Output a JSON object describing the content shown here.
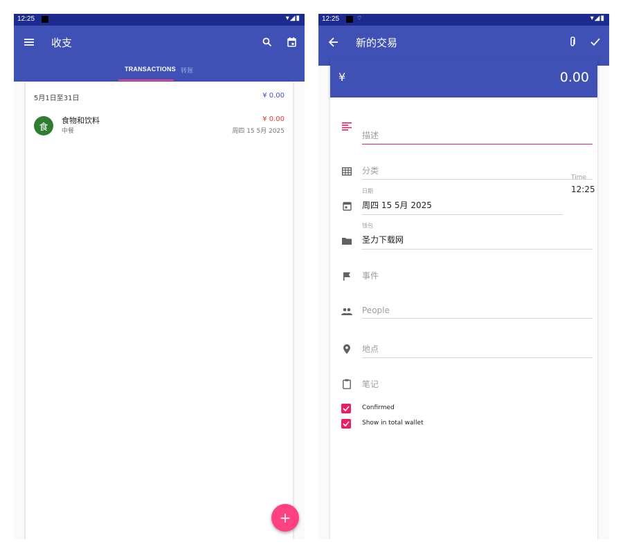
{
  "left": {
    "status_time": "12:25",
    "app_title": "收支",
    "tabs": [
      {
        "label": "TRANSACTIONS",
        "active": true
      },
      {
        "label": "转账",
        "active": false
      }
    ],
    "period_label": "5月1日至31日",
    "period_total": "¥ 0.00",
    "transaction": {
      "avatar_text": "食",
      "title": "食物和饮料",
      "subtitle": "中餐",
      "amount": "¥ 0.00",
      "date": "周四 15 5月 2025"
    },
    "fab_label": "+"
  },
  "right": {
    "status_time": "12:25",
    "app_title": "新的交易",
    "currency_symbol": "¥",
    "amount": "0.00",
    "fields": {
      "description_placeholder": "描述",
      "category_placeholder": "分类",
      "date_caption": "日期",
      "date_value": "周四 15 5月 2025",
      "time_caption": "Time",
      "time_value": "12:25",
      "wallet_caption": "钱包",
      "wallet_value": "圣力下载网",
      "event_placeholder": "事件",
      "people_placeholder": "People",
      "location_placeholder": "地点",
      "note_placeholder": "笔记"
    },
    "checkboxes": [
      {
        "label": "Confirmed",
        "checked": true
      },
      {
        "label": "Show in total wallet",
        "checked": true
      }
    ]
  },
  "colors": {
    "primary": "#3f51b5",
    "primary_dark": "#1d2a8f",
    "accent": "#ff4081",
    "income_expense_red": "#e53935",
    "category_green": "#2e7d32"
  },
  "icons": {
    "left_appbar": [
      "menu-icon",
      "search-icon",
      "calendar-icon"
    ],
    "right_appbar": [
      "back-arrow-icon",
      "attachment-icon",
      "check-icon"
    ],
    "form": [
      "description-icon",
      "category-grid-icon",
      "date-icon",
      "wallet-folder-icon",
      "event-flag-icon",
      "people-icon",
      "location-pin-icon",
      "note-clipboard-icon"
    ]
  }
}
